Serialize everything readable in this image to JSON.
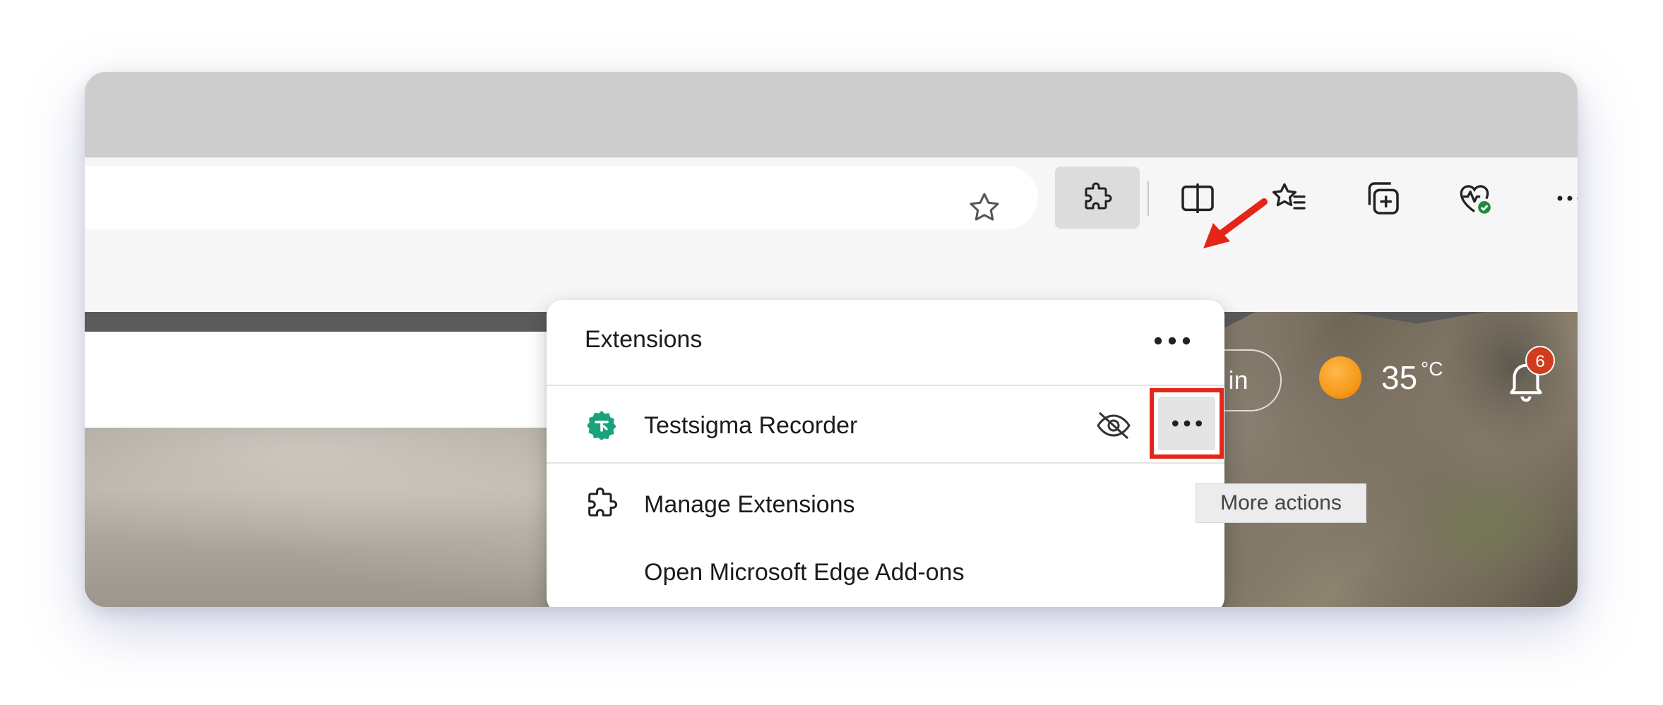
{
  "colors": {
    "accent_highlight": "#e32619",
    "extension_icon_green": "#1aa37a",
    "notification_badge": "#d13b1e",
    "weather_sun": "#f59a1a",
    "tooltip_bg": "#ececec"
  },
  "toolbar": {
    "favorite_icon": "star-icon",
    "extensions_icon": "puzzle-icon",
    "split_screen_icon": "split-screen-icon",
    "favorites_icon": "favorites-icon",
    "collections_icon": "collections-icon",
    "browser_essentials_icon": "heart-pulse-icon",
    "more_icon": "ellipsis-icon"
  },
  "extensions_popup": {
    "title": "Extensions",
    "header_more_icon": "ellipsis-icon",
    "items": [
      {
        "name": "Testsigma Recorder",
        "icon": "testsigma-icon",
        "visibility_icon": "eye-hidden-icon",
        "more_icon": "ellipsis-icon"
      }
    ],
    "manage_label": "Manage Extensions",
    "manage_icon": "puzzle-icon",
    "addons_label": "Open Microsoft Edge Add-ons"
  },
  "tooltip": {
    "text": "More actions"
  },
  "page": {
    "sign_in_label": "Sign in",
    "temperature": "35",
    "temperature_unit": "°C",
    "weather_icon": "sun-icon",
    "notification_icon": "bell-icon",
    "notification_count": "6"
  }
}
